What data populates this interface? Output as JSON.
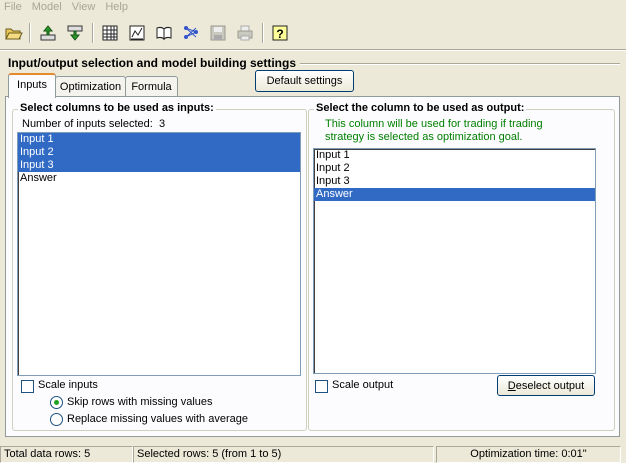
{
  "menu": [
    "File",
    "Model",
    "View",
    "Help"
  ],
  "toolbar": {
    "icons": [
      "open-folder-icon",
      "load-up-icon",
      "load-down-icon",
      "table-icon",
      "chart-icon",
      "book-icon",
      "network-icon",
      "save-icon",
      "print-icon",
      "help-icon"
    ]
  },
  "section_title": "Input/output selection and model building settings",
  "tabs": [
    {
      "label": "Inputs",
      "active": true
    },
    {
      "label": "Optimization",
      "active": false
    },
    {
      "label": "Formula",
      "active": false
    }
  ],
  "default_settings_label": "Default settings",
  "inputs_group": {
    "title": "Select columns to be used as inputs:",
    "count_label": "Number of inputs selected:",
    "count_value": "3",
    "items": [
      {
        "label": "Input 1",
        "selected": true
      },
      {
        "label": "Input 2",
        "selected": true
      },
      {
        "label": "Input 3",
        "selected": true
      },
      {
        "label": "Answer",
        "selected": false
      }
    ],
    "scale_inputs_label": "Scale inputs",
    "scale_inputs_checked": false,
    "skip_rows_label": "Skip rows with missing values",
    "replace_missing_label": "Replace missing values with average",
    "missing_mode": "skip"
  },
  "output_group": {
    "title": "Select the column to be used as output:",
    "note_line1": "This column will be used for trading if trading",
    "note_line2": "strategy is selected as optimization goal.",
    "note_color": "#008000",
    "items": [
      {
        "label": "Input 1",
        "selected": false
      },
      {
        "label": "Input 2",
        "selected": false
      },
      {
        "label": "Input 3",
        "selected": false
      },
      {
        "label": "Answer",
        "selected": true
      }
    ],
    "scale_output_label": "Scale output",
    "scale_output_checked": false,
    "deselect_label_underlined": "D",
    "deselect_label_rest": "eselect output"
  },
  "status": {
    "total_rows": "Total data rows: 5",
    "selected_rows": "Selected rows: 5  (from 1 to 5)",
    "optimization_time": "Optimization time: 0:01\""
  },
  "colors": {
    "selection": "#316ac5",
    "active_tab_accent": "#e68b2c",
    "face": "#ece9d8"
  }
}
